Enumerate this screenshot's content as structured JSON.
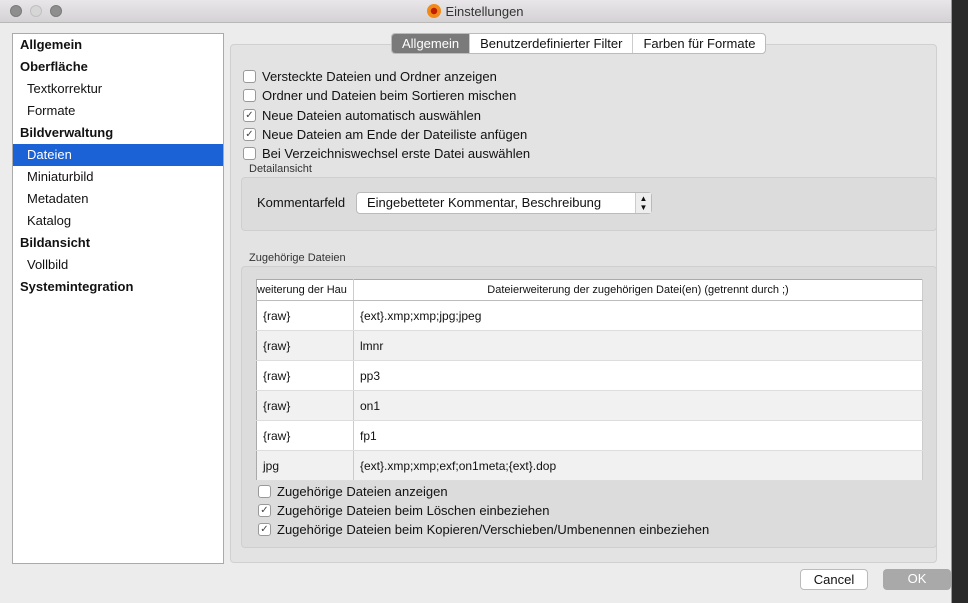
{
  "window": {
    "title": "Einstellungen"
  },
  "sidebar": {
    "items": [
      {
        "label": "Allgemein",
        "level": 0
      },
      {
        "label": "Oberfläche",
        "level": 0
      },
      {
        "label": "Textkorrektur",
        "level": 1
      },
      {
        "label": "Formate",
        "level": 1
      },
      {
        "label": "Bildverwaltung",
        "level": 0
      },
      {
        "label": "Dateien",
        "level": 1,
        "selected": true
      },
      {
        "label": "Miniaturbild",
        "level": 1
      },
      {
        "label": "Metadaten",
        "level": 1
      },
      {
        "label": "Katalog",
        "level": 1
      },
      {
        "label": "Bildansicht",
        "level": 0
      },
      {
        "label": "Vollbild",
        "level": 1
      },
      {
        "label": "Systemintegration",
        "level": 0
      }
    ]
  },
  "tabs": [
    "Allgemein",
    "Benutzerdefinierter Filter",
    "Farben für Formate"
  ],
  "options": [
    {
      "label": "Versteckte Dateien und Ordner anzeigen",
      "checked": false
    },
    {
      "label": "Ordner und Dateien beim Sortieren mischen",
      "checked": false
    },
    {
      "label": "Neue Dateien automatisch auswählen",
      "checked": true
    },
    {
      "label": "Neue Dateien am Ende der Dateiliste anfügen",
      "checked": true
    },
    {
      "label": "Bei Verzeichniswechsel erste Datei auswählen",
      "checked": false
    }
  ],
  "detail": {
    "group": "Detailansicht",
    "field_label": "Kommentarfeld",
    "field_value": "Eingebetteter Kommentar, Beschreibung"
  },
  "related": {
    "group": "Zugehörige Dateien",
    "columns": [
      "weiterung der Hau",
      "Dateierweiterung der zugehörigen Datei(en) (getrennt durch ;)"
    ],
    "rows": [
      [
        "{raw}",
        "{ext}.xmp;xmp;jpg;jpeg"
      ],
      [
        "{raw}",
        "lmnr"
      ],
      [
        "{raw}",
        "pp3"
      ],
      [
        "{raw}",
        "on1"
      ],
      [
        "{raw}",
        "fp1"
      ],
      [
        "jpg",
        "{ext}.xmp;xmp;exf;on1meta;{ext}.dop"
      ]
    ],
    "options": [
      {
        "label": "Zugehörige Dateien anzeigen",
        "checked": false
      },
      {
        "label": "Zugehörige Dateien beim Löschen einbeziehen",
        "checked": true
      },
      {
        "label": "Zugehörige Dateien beim Kopieren/Verschieben/Umbenennen einbeziehen",
        "checked": true
      }
    ]
  },
  "buttons": {
    "cancel": "Cancel",
    "ok": "OK"
  }
}
